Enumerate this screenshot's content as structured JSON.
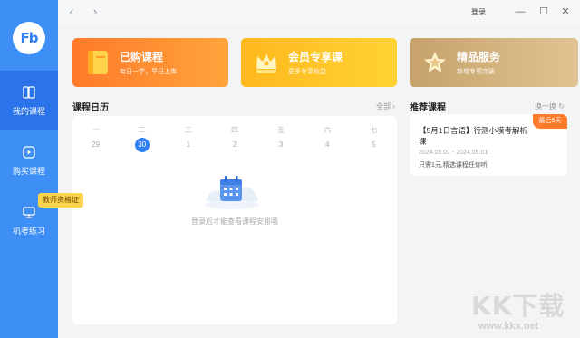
{
  "sidebar": {
    "logo": "Fb",
    "items": [
      {
        "label": "我的课程",
        "icon": "book-open-icon",
        "active": true
      },
      {
        "label": "购买课程",
        "icon": "play-icon",
        "active": false
      },
      {
        "label": "机考练习",
        "icon": "computer-icon",
        "active": false
      }
    ],
    "badge": "教师资格证"
  },
  "topbar": {
    "back_icon": "chevron-left-icon",
    "forward_icon": "chevron-right-icon",
    "login": "登录",
    "min": "—",
    "max": "☐",
    "close": "✕"
  },
  "cards": [
    {
      "title": "已购课程",
      "subtitle": "每日一学，早日上岸",
      "icon": "book-icon",
      "color": "#ff8a2f"
    },
    {
      "title": "会员专享课",
      "subtitle": "更多专享权益",
      "icon": "crown-icon",
      "color": "#ffc52a"
    },
    {
      "title": "精品服务",
      "subtitle": "新增专项突破",
      "icon": "star-icon",
      "color": "#d4b47f"
    }
  ],
  "calendar": {
    "title": "课程日历",
    "link": "全部 ›",
    "weekdays": [
      "一",
      "二",
      "三",
      "四",
      "五",
      "六",
      "七"
    ],
    "dates": [
      "29",
      "30",
      "1",
      "2",
      "3",
      "4",
      "5"
    ],
    "today": "30",
    "empty_text": "登录后才能查看课程安排哦"
  },
  "recommend": {
    "title": "推荐课程",
    "link": "换一换 ↻",
    "course": {
      "ribbon": "最后5天",
      "name": "【5月1日言语】行测小模考解析课",
      "date": "2024.05.01 - 2024.05.01",
      "desc": "只需1元,精选课程任你听"
    }
  },
  "watermark": {
    "big": "KK下载",
    "small": "www.kkx.net"
  }
}
